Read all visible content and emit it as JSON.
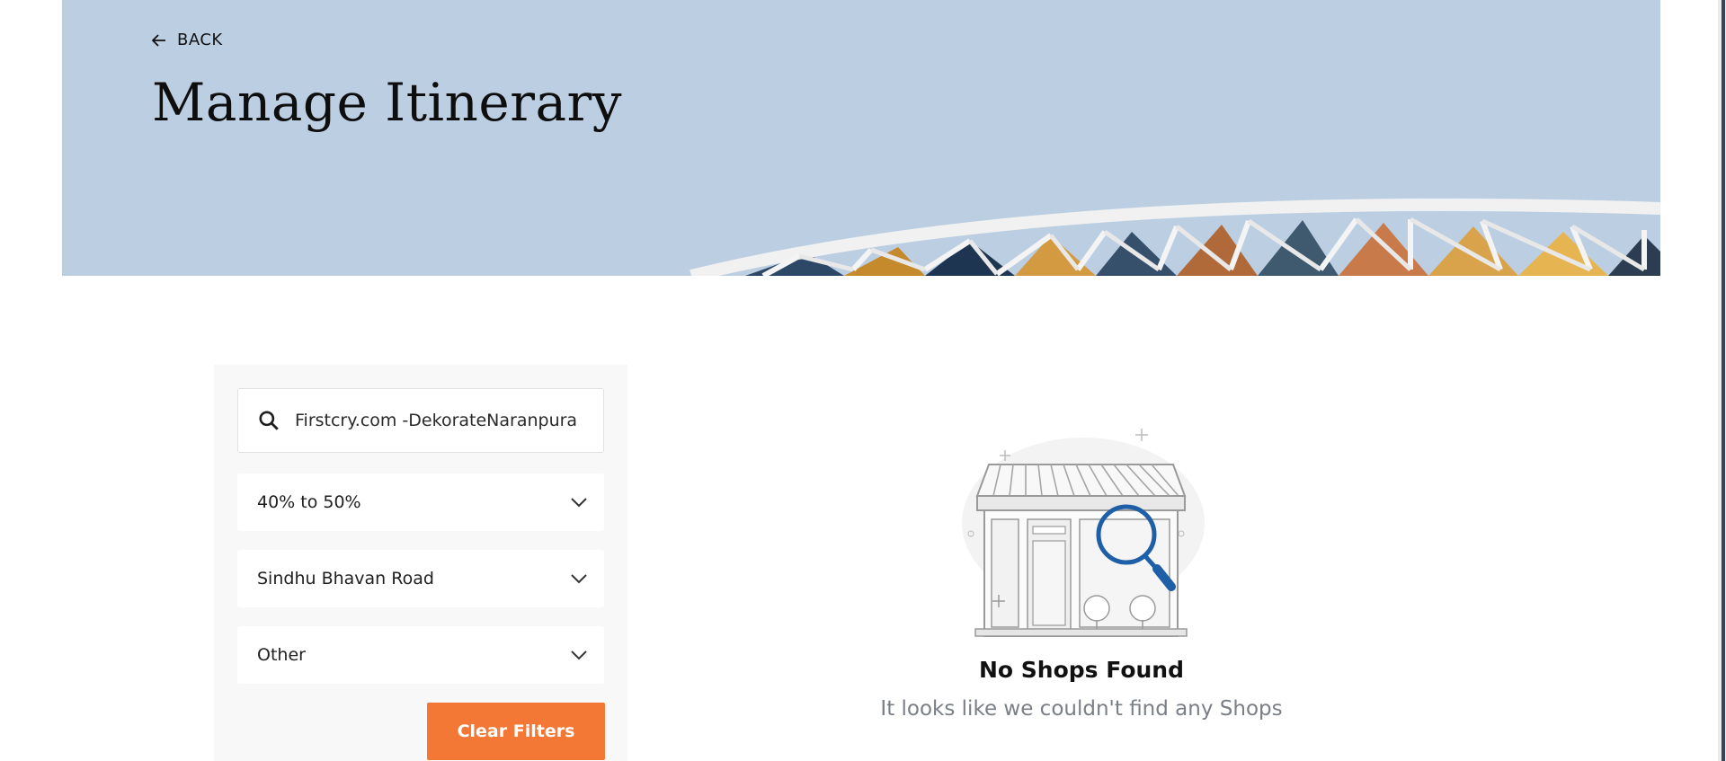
{
  "header": {
    "back_label": "BACK",
    "title": "Manage Itinerary"
  },
  "filters": {
    "search": {
      "value": "Firstcry.com -DekorateNaranpura",
      "icon": "search-icon"
    },
    "discount": {
      "selected": "40% to 50%"
    },
    "area": {
      "selected": "Sindhu Bhavan Road"
    },
    "category": {
      "selected": "Other"
    },
    "clear_label": "Clear Filters"
  },
  "empty_state": {
    "title": "No Shops Found",
    "subtitle": "It looks like we couldn't find any Shops"
  },
  "colors": {
    "hero_bg": "#bccfe2",
    "accent": "#f37735",
    "magnifier": "#1f5fa8"
  }
}
